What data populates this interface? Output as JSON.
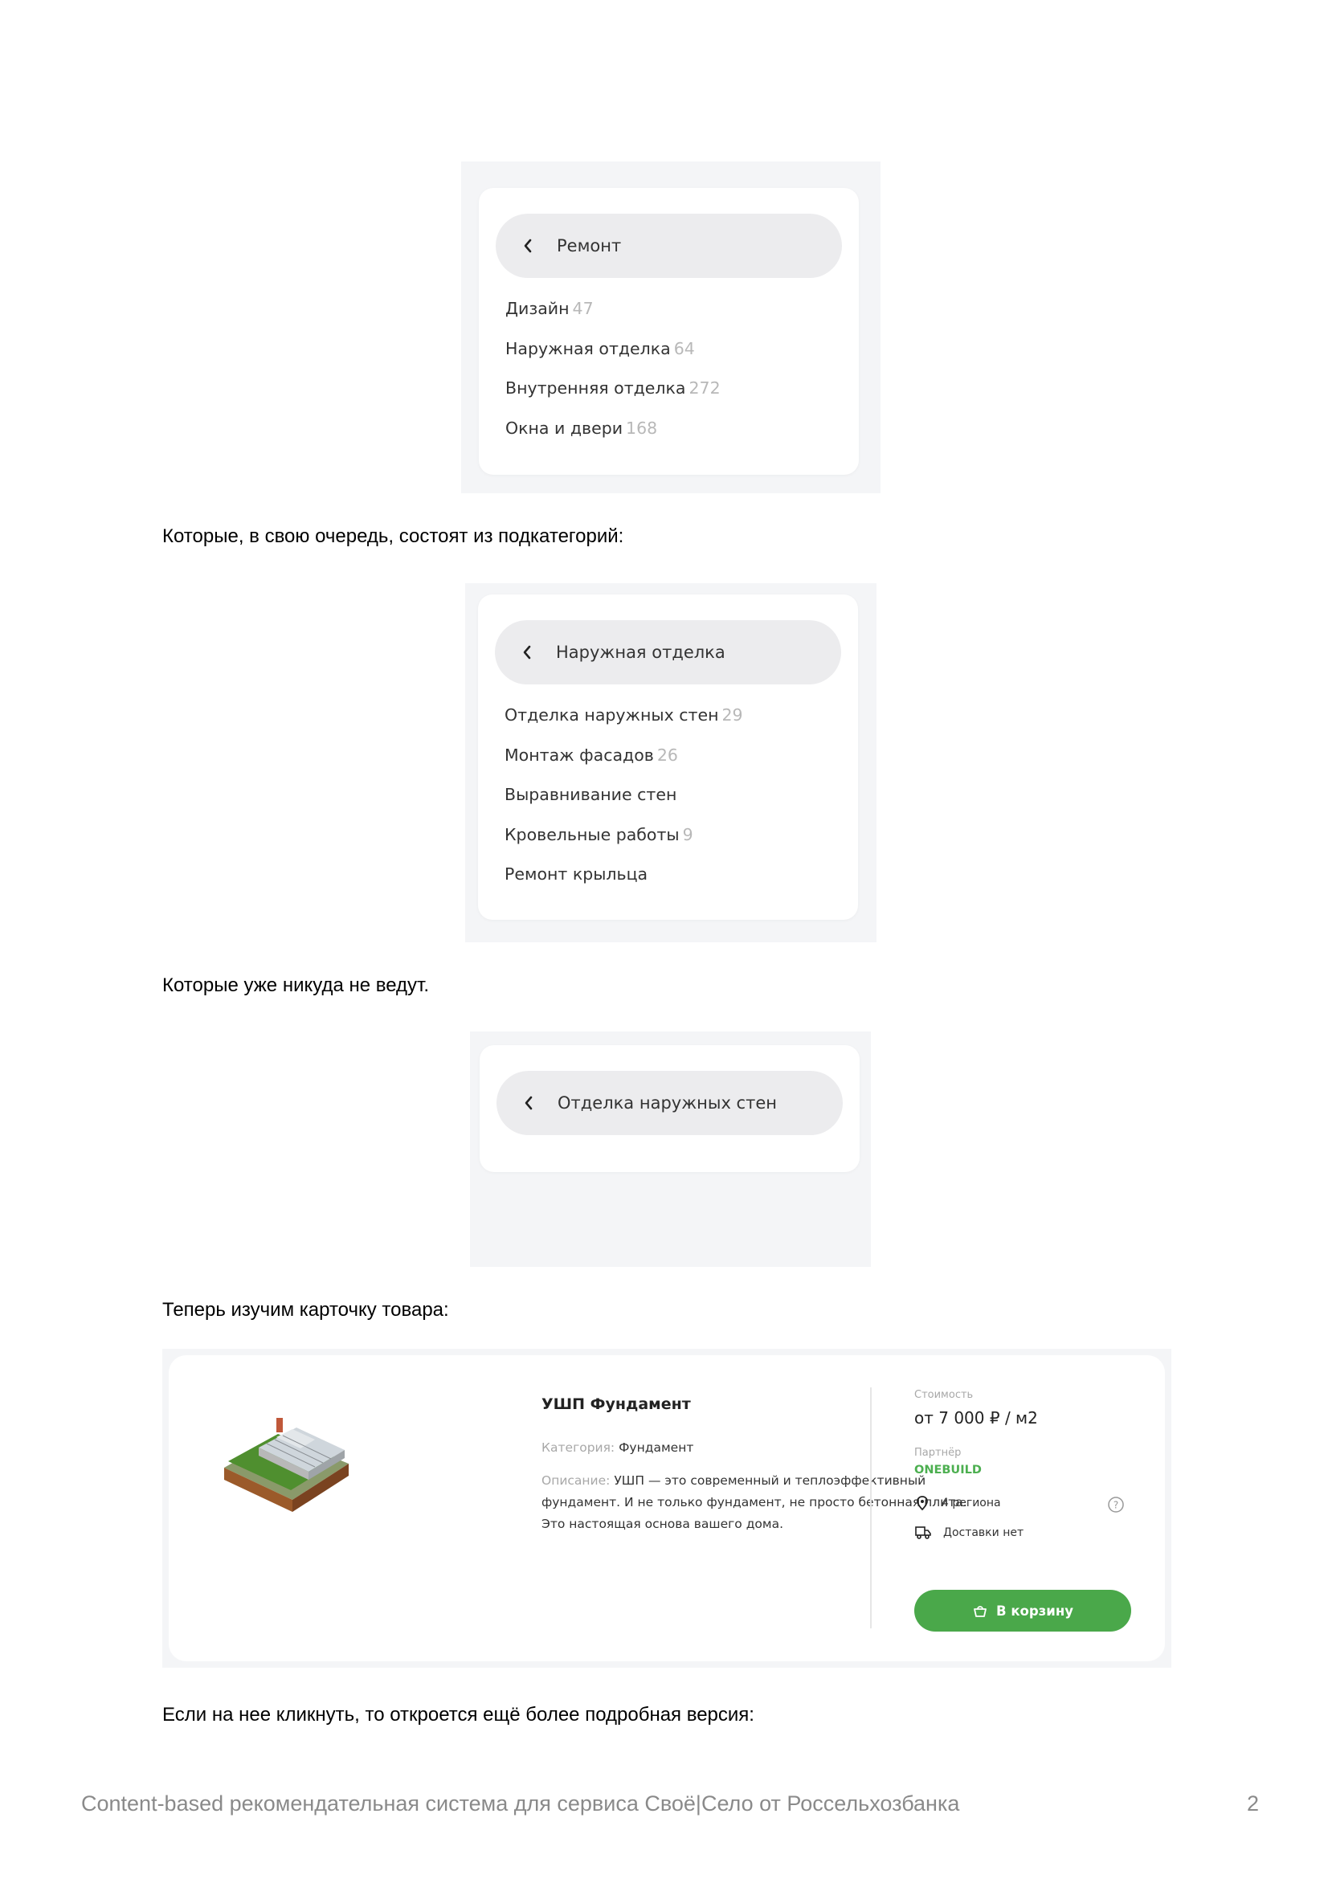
{
  "panel1": {
    "header": "Ремонт",
    "items": [
      {
        "label": "Дизайн",
        "count": "47"
      },
      {
        "label": "Наружная отделка",
        "count": "64"
      },
      {
        "label": "Внутренняя отделка",
        "count": "272"
      },
      {
        "label": "Окна и двери",
        "count": "168"
      }
    ]
  },
  "para1": "Которые, в свою очередь, состоят из подкатегорий:",
  "panel2": {
    "header": "Наружная отделка",
    "items": [
      {
        "label": "Отделка наружных стен",
        "count": "29"
      },
      {
        "label": "Монтаж фасадов",
        "count": "26"
      },
      {
        "label": "Выравнивание стен",
        "count": ""
      },
      {
        "label": "Кровельные работы",
        "count": "9"
      },
      {
        "label": "Ремонт крыльца",
        "count": ""
      }
    ]
  },
  "para2": "Которые уже никуда не ведут.",
  "panel3": {
    "header": "Отделка наружных стен"
  },
  "para3": "Теперь изучим карточку товара:",
  "product": {
    "title": "УШП Фундамент",
    "category_label": "Категория:",
    "category_value": "Фундамент",
    "description_label": "Описание:",
    "description_line1": "УШП — это современный и теплоэффективный",
    "description_line2": "фундамент. И не только фундамент, не просто бетонная плита.",
    "description_line3": "Это настоящая основа вашего дома.",
    "price_label": "Стоимость",
    "price": "от 7 000 ₽ / м2",
    "partner_label": "Партнёр",
    "partner": "ONEBUILD",
    "regions": "4 региона",
    "delivery": "Доставки нет",
    "cart_button": "В корзину",
    "accent_color": "#4aa84a"
  },
  "para4": "Если на нее кликнуть, то откроется ещё более подробная версия:",
  "footer": {
    "text": "Content-based рекомендательная система для сервиса Своё|Село от Россельхозбанка",
    "page_number": "2"
  }
}
